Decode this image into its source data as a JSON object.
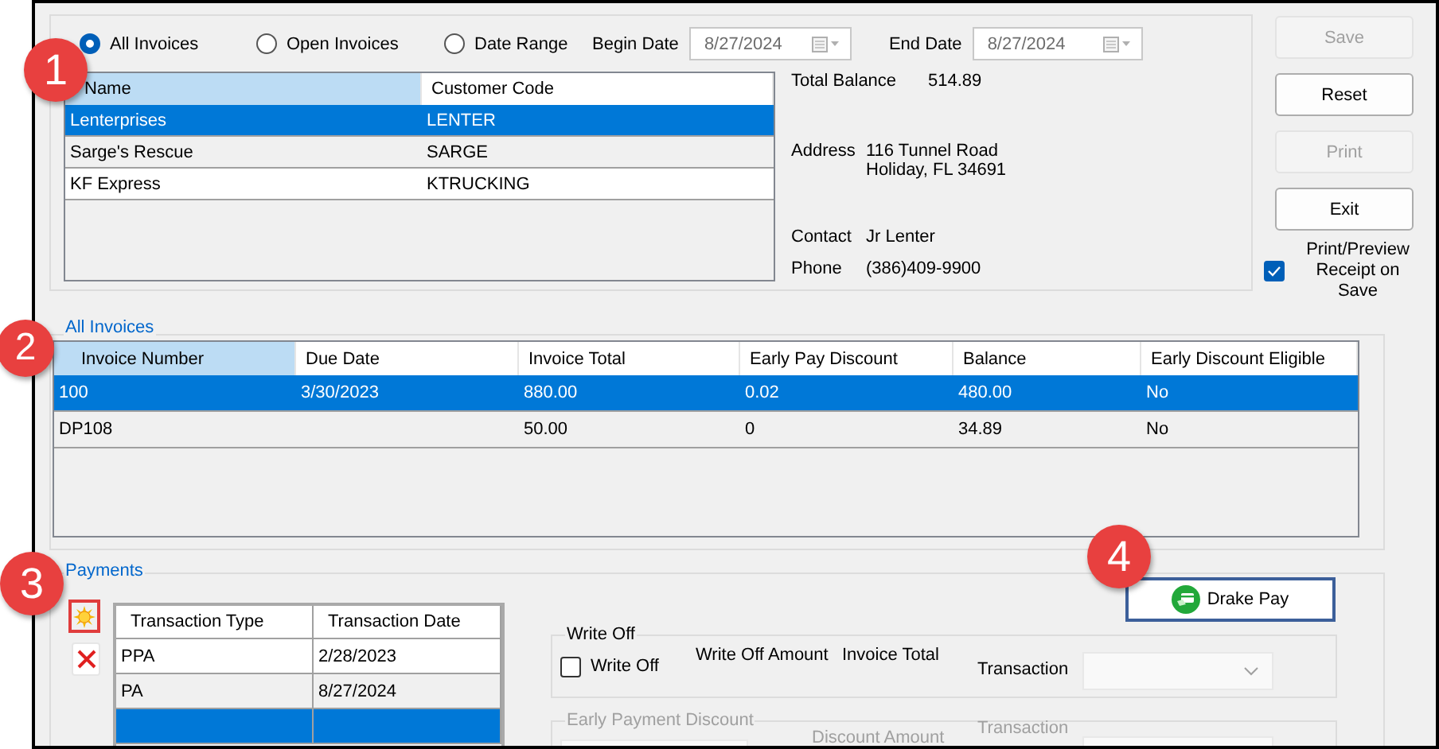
{
  "filters": [
    {
      "label": "All Invoices",
      "selected": true
    },
    {
      "label": "Open Invoices",
      "selected": false
    },
    {
      "label": "Date Range",
      "selected": false
    }
  ],
  "begin_date": {
    "label": "Begin Date",
    "value": "8/27/2024",
    "disabled": true
  },
  "end_date": {
    "label": "End Date",
    "value": "8/27/2024",
    "disabled": true
  },
  "customers": {
    "columns": [
      {
        "label": "Name",
        "selected": true
      },
      {
        "label": "Customer Code",
        "selected": false
      }
    ],
    "rows": [
      {
        "cells": [
          "Lenterprises",
          "LENTER"
        ],
        "selected": true
      },
      {
        "cells": [
          "Sarge's Rescue",
          "SARGE"
        ],
        "selected": false
      },
      {
        "cells": [
          "KF Express",
          "KTRUCKING"
        ],
        "selected": false
      }
    ]
  },
  "customer_info": {
    "total_balance": {
      "label": "Total Balance",
      "value": "514.89"
    },
    "address": {
      "label": "Address",
      "lines": [
        "116 Tunnel Road",
        "Holiday, FL 34691"
      ]
    },
    "contact": {
      "label": "Contact",
      "value": "Jr Lenter"
    },
    "phone": {
      "label": "Phone",
      "value": "(386)409-9900"
    }
  },
  "buttons": [
    {
      "label": "Save",
      "disabled": true
    },
    {
      "label": "Reset",
      "disabled": false
    },
    {
      "label": "Print",
      "disabled": true
    },
    {
      "label": "Exit",
      "disabled": false
    }
  ],
  "print_preview": {
    "label": "Print/Preview Receipt on Save",
    "checked": true
  },
  "invoices": {
    "title": "All Invoices",
    "columns": [
      {
        "label": "Invoice Number",
        "selected": true
      },
      {
        "label": "Due Date",
        "selected": false
      },
      {
        "label": "Invoice Total",
        "selected": false
      },
      {
        "label": "Early Pay Discount",
        "selected": false
      },
      {
        "label": "Balance",
        "selected": false
      },
      {
        "label": "Early Discount Eligible",
        "selected": false
      }
    ],
    "rows": [
      {
        "cells": [
          "100",
          "3/30/2023",
          "880.00",
          "0.02",
          "480.00",
          "No"
        ],
        "selected": true
      },
      {
        "cells": [
          "DP108",
          "",
          "50.00",
          "0",
          "34.89",
          "No"
        ],
        "selected": false
      }
    ]
  },
  "payments": {
    "title": "Payments",
    "columns": [
      {
        "label": "Transaction Type",
        "selected": false
      },
      {
        "label": "Transaction Date",
        "selected": false
      }
    ],
    "rows": [
      {
        "cells": [
          "PPA",
          "2/28/2023"
        ],
        "selected": false
      },
      {
        "cells": [
          "PA",
          "8/27/2024"
        ],
        "selected": false
      },
      {
        "selected": true
      }
    ]
  },
  "drake_pay": {
    "label": "Drake Pay"
  },
  "write_off": {
    "title": "Write Off",
    "disabled": false,
    "checkbox": {
      "label": "Write Off",
      "checked": false
    },
    "labels": [
      "Write Off Amount",
      "Invoice Total"
    ],
    "transaction_label": "Transaction"
  },
  "early_payment_discount": {
    "title": "Early Payment Discount",
    "disabled": true,
    "labels": [
      "Discount Amount"
    ],
    "transaction_label": "Transaction"
  },
  "callouts": [
    "1",
    "2",
    "3",
    "4"
  ]
}
